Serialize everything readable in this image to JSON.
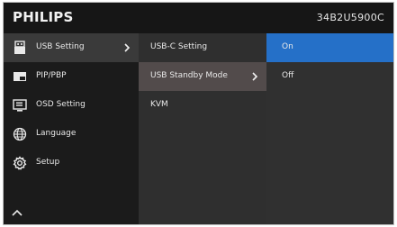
{
  "header": {
    "brand": "PHILIPS",
    "model": "34B2U5900C"
  },
  "menu": {
    "items": [
      {
        "label": "USB Setting",
        "icon": "usb-icon",
        "selected": true
      },
      {
        "label": "PIP/PBP",
        "icon": "pip-icon",
        "selected": false
      },
      {
        "label": "OSD Setting",
        "icon": "osd-icon",
        "selected": false
      },
      {
        "label": "Language",
        "icon": "globe-icon",
        "selected": false
      },
      {
        "label": "Setup",
        "icon": "gear-icon",
        "selected": false
      }
    ],
    "up_icon": "chevron-up-icon"
  },
  "submenu": {
    "items": [
      {
        "label": "USB-C Setting"
      },
      {
        "label": "USB Standby Mode",
        "selected": true
      },
      {
        "label": "KVM"
      }
    ]
  },
  "options": {
    "items": [
      {
        "label": "On",
        "selected": true
      },
      {
        "label": "Off",
        "selected": false
      }
    ]
  },
  "colors": {
    "accent": "#2570c8",
    "header_bg": "#161616",
    "panel_bg": "#2f2f2f"
  }
}
